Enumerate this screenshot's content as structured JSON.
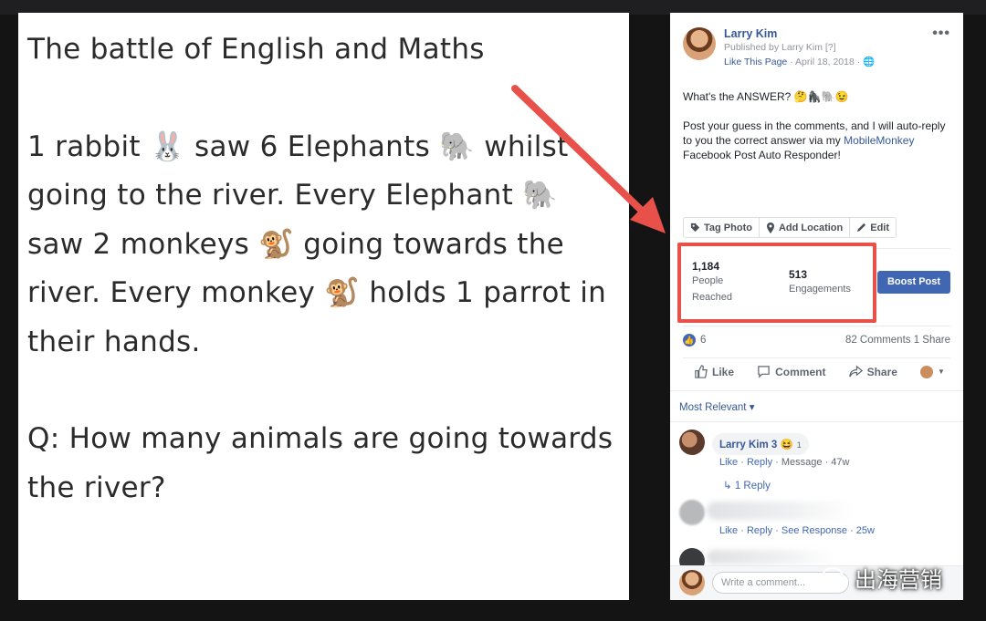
{
  "image_text": {
    "line1": "The battle of English and Maths",
    "line2": "1 rabbit 🐰 saw 6 Elephants 🐘 whilst going to the river. Every Elephant 🐘 saw 2 monkeys 🐒 going towards the river. Every monkey 🐒 holds 1 parrot in their hands.",
    "line3": "Q: How many animals are going towards the river?"
  },
  "post": {
    "author": "Larry Kim",
    "published_by": "Published by Larry Kim [?]",
    "meta_link": "Like This Page",
    "meta_date": "· April 18, 2018 ·",
    "more": "•••",
    "question": "What's the ANSWER? 🤔🦍🐘😉",
    "body_pre": "Post your guess in the comments, and I will auto-reply to you the correct answer via my ",
    "body_link": "MobileMonkey",
    "body_post": " Facebook Post Auto Responder!"
  },
  "tag_bar": {
    "tag_photo": "Tag Photo",
    "add_location": "Add Location",
    "edit": "Edit"
  },
  "stats": {
    "reached_num": "1,184",
    "reached_lbl": "People\nReached",
    "engagements_num": "513",
    "engagements_lbl": "Engagements",
    "boost": "Boost Post"
  },
  "reactions": {
    "count": "6",
    "comments_shares": "82 Comments  1 Share"
  },
  "actions": {
    "like": "Like",
    "comment": "Comment",
    "share": "Share"
  },
  "sort": {
    "label": "Most Relevant ▾"
  },
  "comments": [
    {
      "author": "Larry Kim 3 😆",
      "count": "1",
      "meta_like": "Like",
      "meta_reply": "Reply",
      "meta_rest": "· Message · 47w",
      "replies": "↳  1 Reply"
    },
    {
      "meta_like": "Like",
      "meta_reply": "Reply",
      "meta_rest": "· See Response · 25w"
    }
  ],
  "composer": {
    "placeholder": "Write a comment..."
  },
  "watermark": "出海营销",
  "colors": {
    "fb_blue": "#4267b2",
    "link_blue": "#365899",
    "highlight_red": "#e8514a"
  }
}
